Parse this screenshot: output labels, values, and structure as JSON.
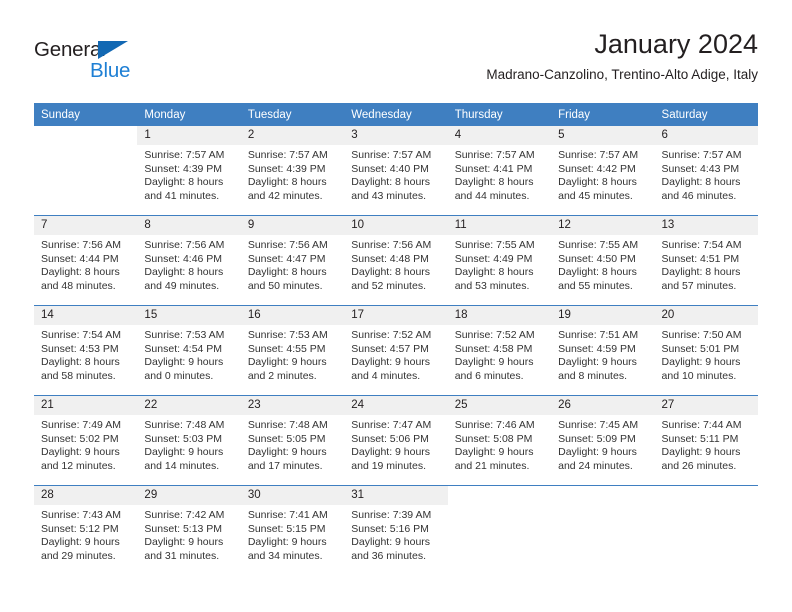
{
  "brand": {
    "name_part1": "General",
    "name_part2": "Blue",
    "triangle_icon": "triangle-icon",
    "accent_color": "#1e7fd4"
  },
  "header": {
    "title": "January 2024",
    "location": "Madrano-Canzolino, Trentino-Alto Adige, Italy"
  },
  "theme": {
    "header_blue": "#3f7fc1",
    "daynum_band": "#f0f0f0",
    "text": "#231f20"
  },
  "weekday_headers": [
    "Sunday",
    "Monday",
    "Tuesday",
    "Wednesday",
    "Thursday",
    "Friday",
    "Saturday"
  ],
  "weeks": [
    [
      {
        "day": "",
        "blank": true,
        "lines": []
      },
      {
        "day": "1",
        "lines": [
          "Sunrise: 7:57 AM",
          "Sunset: 4:39 PM",
          "Daylight: 8 hours",
          "and 41 minutes."
        ]
      },
      {
        "day": "2",
        "lines": [
          "Sunrise: 7:57 AM",
          "Sunset: 4:39 PM",
          "Daylight: 8 hours",
          "and 42 minutes."
        ]
      },
      {
        "day": "3",
        "lines": [
          "Sunrise: 7:57 AM",
          "Sunset: 4:40 PM",
          "Daylight: 8 hours",
          "and 43 minutes."
        ]
      },
      {
        "day": "4",
        "lines": [
          "Sunrise: 7:57 AM",
          "Sunset: 4:41 PM",
          "Daylight: 8 hours",
          "and 44 minutes."
        ]
      },
      {
        "day": "5",
        "lines": [
          "Sunrise: 7:57 AM",
          "Sunset: 4:42 PM",
          "Daylight: 8 hours",
          "and 45 minutes."
        ]
      },
      {
        "day": "6",
        "lines": [
          "Sunrise: 7:57 AM",
          "Sunset: 4:43 PM",
          "Daylight: 8 hours",
          "and 46 minutes."
        ]
      }
    ],
    [
      {
        "day": "7",
        "lines": [
          "Sunrise: 7:56 AM",
          "Sunset: 4:44 PM",
          "Daylight: 8 hours",
          "and 48 minutes."
        ]
      },
      {
        "day": "8",
        "lines": [
          "Sunrise: 7:56 AM",
          "Sunset: 4:46 PM",
          "Daylight: 8 hours",
          "and 49 minutes."
        ]
      },
      {
        "day": "9",
        "lines": [
          "Sunrise: 7:56 AM",
          "Sunset: 4:47 PM",
          "Daylight: 8 hours",
          "and 50 minutes."
        ]
      },
      {
        "day": "10",
        "lines": [
          "Sunrise: 7:56 AM",
          "Sunset: 4:48 PM",
          "Daylight: 8 hours",
          "and 52 minutes."
        ]
      },
      {
        "day": "11",
        "lines": [
          "Sunrise: 7:55 AM",
          "Sunset: 4:49 PM",
          "Daylight: 8 hours",
          "and 53 minutes."
        ]
      },
      {
        "day": "12",
        "lines": [
          "Sunrise: 7:55 AM",
          "Sunset: 4:50 PM",
          "Daylight: 8 hours",
          "and 55 minutes."
        ]
      },
      {
        "day": "13",
        "lines": [
          "Sunrise: 7:54 AM",
          "Sunset: 4:51 PM",
          "Daylight: 8 hours",
          "and 57 minutes."
        ]
      }
    ],
    [
      {
        "day": "14",
        "lines": [
          "Sunrise: 7:54 AM",
          "Sunset: 4:53 PM",
          "Daylight: 8 hours",
          "and 58 minutes."
        ]
      },
      {
        "day": "15",
        "lines": [
          "Sunrise: 7:53 AM",
          "Sunset: 4:54 PM",
          "Daylight: 9 hours",
          "and 0 minutes."
        ]
      },
      {
        "day": "16",
        "lines": [
          "Sunrise: 7:53 AM",
          "Sunset: 4:55 PM",
          "Daylight: 9 hours",
          "and 2 minutes."
        ]
      },
      {
        "day": "17",
        "lines": [
          "Sunrise: 7:52 AM",
          "Sunset: 4:57 PM",
          "Daylight: 9 hours",
          "and 4 minutes."
        ]
      },
      {
        "day": "18",
        "lines": [
          "Sunrise: 7:52 AM",
          "Sunset: 4:58 PM",
          "Daylight: 9 hours",
          "and 6 minutes."
        ]
      },
      {
        "day": "19",
        "lines": [
          "Sunrise: 7:51 AM",
          "Sunset: 4:59 PM",
          "Daylight: 9 hours",
          "and 8 minutes."
        ]
      },
      {
        "day": "20",
        "lines": [
          "Sunrise: 7:50 AM",
          "Sunset: 5:01 PM",
          "Daylight: 9 hours",
          "and 10 minutes."
        ]
      }
    ],
    [
      {
        "day": "21",
        "lines": [
          "Sunrise: 7:49 AM",
          "Sunset: 5:02 PM",
          "Daylight: 9 hours",
          "and 12 minutes."
        ]
      },
      {
        "day": "22",
        "lines": [
          "Sunrise: 7:48 AM",
          "Sunset: 5:03 PM",
          "Daylight: 9 hours",
          "and 14 minutes."
        ]
      },
      {
        "day": "23",
        "lines": [
          "Sunrise: 7:48 AM",
          "Sunset: 5:05 PM",
          "Daylight: 9 hours",
          "and 17 minutes."
        ]
      },
      {
        "day": "24",
        "lines": [
          "Sunrise: 7:47 AM",
          "Sunset: 5:06 PM",
          "Daylight: 9 hours",
          "and 19 minutes."
        ]
      },
      {
        "day": "25",
        "lines": [
          "Sunrise: 7:46 AM",
          "Sunset: 5:08 PM",
          "Daylight: 9 hours",
          "and 21 minutes."
        ]
      },
      {
        "day": "26",
        "lines": [
          "Sunrise: 7:45 AM",
          "Sunset: 5:09 PM",
          "Daylight: 9 hours",
          "and 24 minutes."
        ]
      },
      {
        "day": "27",
        "lines": [
          "Sunrise: 7:44 AM",
          "Sunset: 5:11 PM",
          "Daylight: 9 hours",
          "and 26 minutes."
        ]
      }
    ],
    [
      {
        "day": "28",
        "lines": [
          "Sunrise: 7:43 AM",
          "Sunset: 5:12 PM",
          "Daylight: 9 hours",
          "and 29 minutes."
        ]
      },
      {
        "day": "29",
        "lines": [
          "Sunrise: 7:42 AM",
          "Sunset: 5:13 PM",
          "Daylight: 9 hours",
          "and 31 minutes."
        ]
      },
      {
        "day": "30",
        "lines": [
          "Sunrise: 7:41 AM",
          "Sunset: 5:15 PM",
          "Daylight: 9 hours",
          "and 34 minutes."
        ]
      },
      {
        "day": "31",
        "lines": [
          "Sunrise: 7:39 AM",
          "Sunset: 5:16 PM",
          "Daylight: 9 hours",
          "and 36 minutes."
        ]
      },
      {
        "day": "",
        "blank": true,
        "lines": []
      },
      {
        "day": "",
        "blank": true,
        "lines": []
      },
      {
        "day": "",
        "blank": true,
        "lines": []
      }
    ]
  ]
}
